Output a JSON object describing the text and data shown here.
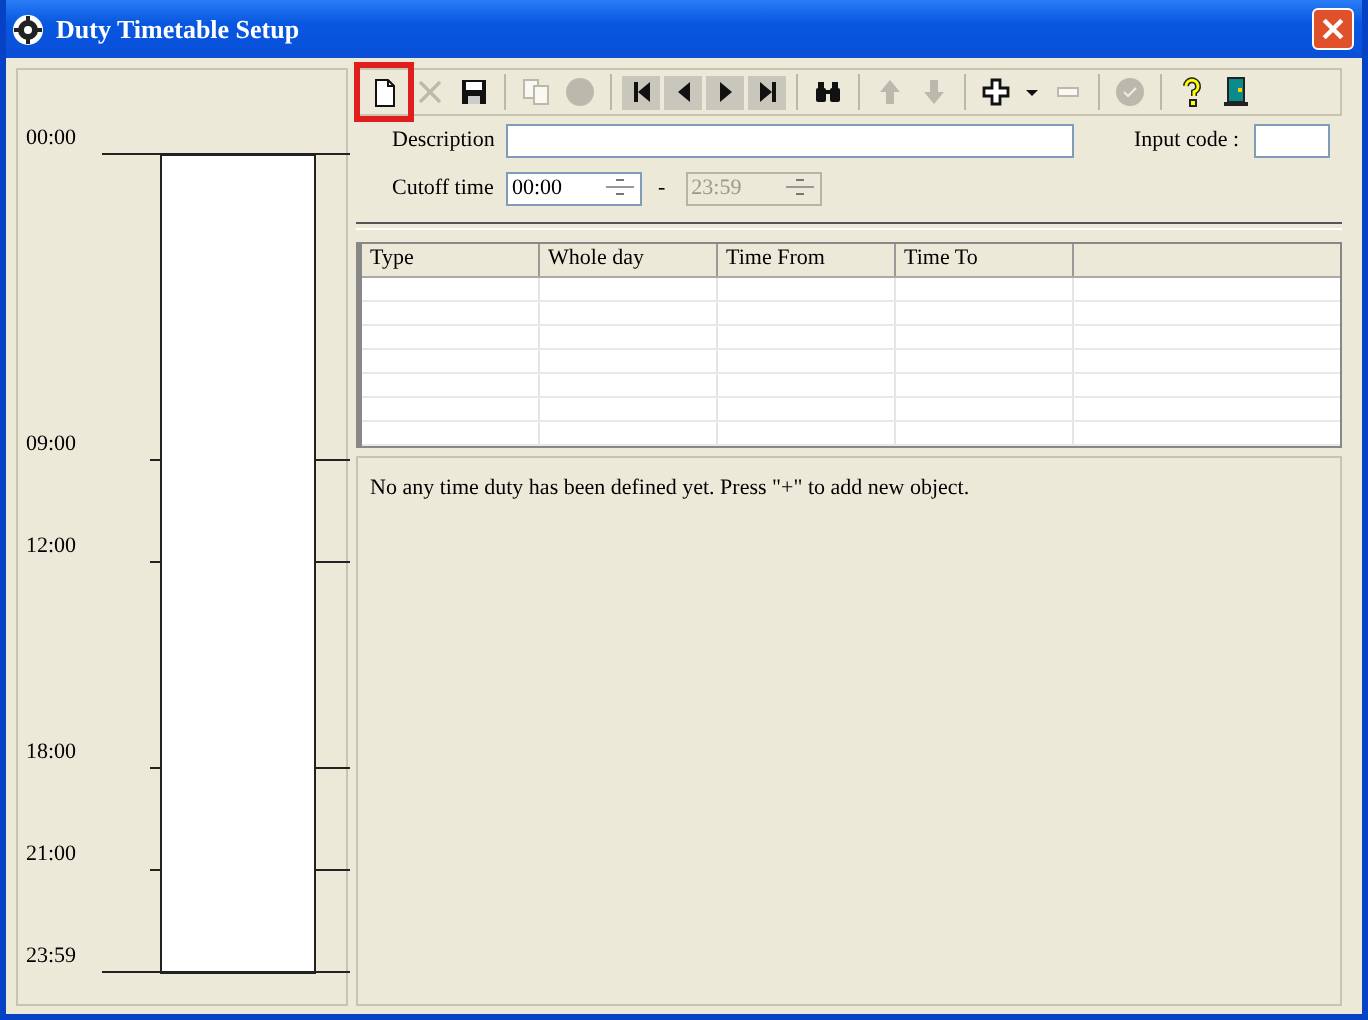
{
  "window": {
    "title": "Duty Timetable Setup"
  },
  "timeline": {
    "labels": [
      "00:00",
      "09:00",
      "12:00",
      "18:00",
      "21:00",
      "23:59"
    ]
  },
  "toolbar": [
    {
      "kind": "new",
      "disabled": false,
      "highlighted": true
    },
    {
      "kind": "delete",
      "disabled": true,
      "highlighted": false
    },
    {
      "kind": "save",
      "disabled": false,
      "highlighted": false
    },
    {
      "kind": "sep"
    },
    {
      "kind": "copy",
      "disabled": true,
      "highlighted": false
    },
    {
      "kind": "stop",
      "disabled": true,
      "highlighted": false
    },
    {
      "kind": "sep"
    },
    {
      "kind": "first",
      "disabled": false,
      "highlighted": false
    },
    {
      "kind": "prev",
      "disabled": false,
      "highlighted": false
    },
    {
      "kind": "next",
      "disabled": false,
      "highlighted": false
    },
    {
      "kind": "last",
      "disabled": false,
      "highlighted": false
    },
    {
      "kind": "sep"
    },
    {
      "kind": "find",
      "disabled": false,
      "highlighted": false
    },
    {
      "kind": "sep"
    },
    {
      "kind": "up",
      "disabled": true,
      "highlighted": false
    },
    {
      "kind": "down",
      "disabled": true,
      "highlighted": false
    },
    {
      "kind": "sep"
    },
    {
      "kind": "add",
      "disabled": false,
      "highlighted": false
    },
    {
      "kind": "caret",
      "disabled": false,
      "highlighted": false
    },
    {
      "kind": "remove",
      "disabled": true,
      "highlighted": false
    },
    {
      "kind": "sep"
    },
    {
      "kind": "check",
      "disabled": true,
      "highlighted": false
    },
    {
      "kind": "sep"
    },
    {
      "kind": "help",
      "disabled": false,
      "highlighted": false
    },
    {
      "kind": "exit",
      "disabled": false,
      "highlighted": false
    }
  ],
  "form": {
    "description_label": "Description",
    "input_code_label": "Input code :",
    "cutoff_label": "Cutoff time",
    "cutoff_from": {
      "value": "00:00",
      "disabled": false
    },
    "dash": "-",
    "cutoff_to": {
      "value": "23:59",
      "disabled": true
    }
  },
  "table": {
    "columns": [
      "Type",
      "Whole day",
      "Time From",
      "Time To"
    ]
  },
  "message": "No any time duty has been defined yet. Press \"+\" to add new object."
}
